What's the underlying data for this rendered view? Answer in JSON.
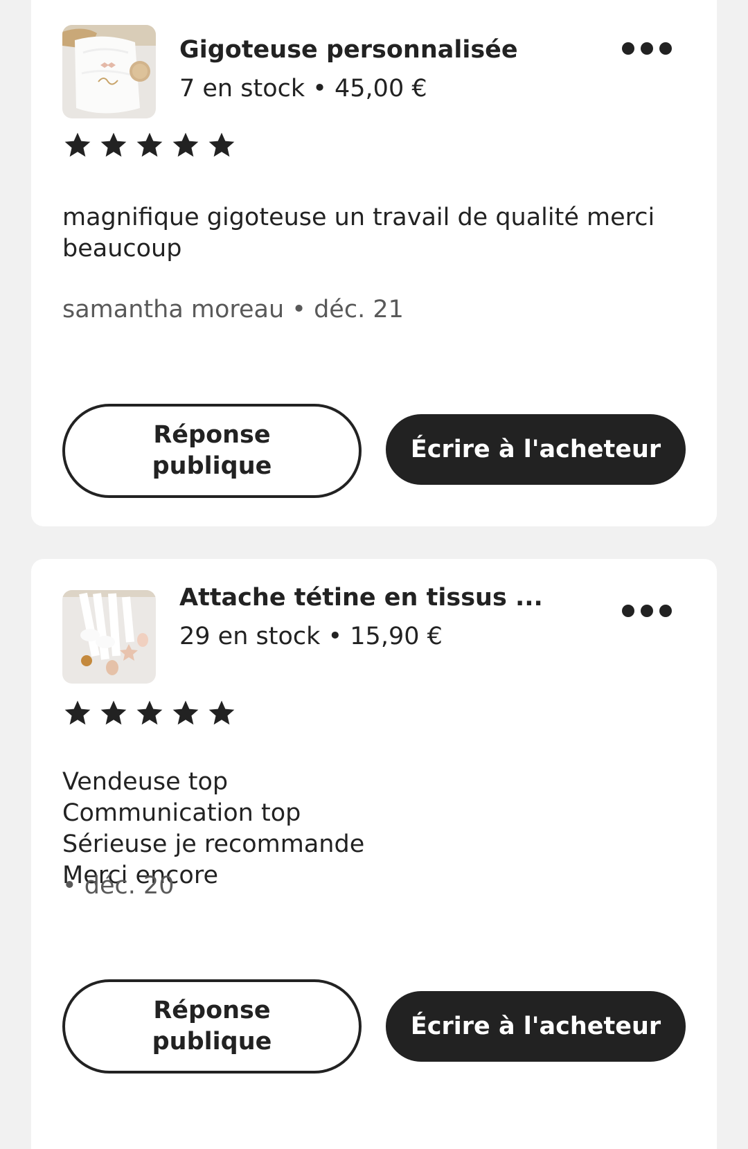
{
  "reviews": [
    {
      "product_title": "Gigoteuse personnalisée",
      "product_meta": "7 en stock • 45,00 €",
      "product_image": "baby-sleeping-bag-photo",
      "rating": 5,
      "review_text": "magnifique gigoteuse un travail de qualité merci beaucoup",
      "byline": "samantha moreau • déc. 21",
      "public_reply_label": "Réponse\npublique",
      "message_buyer_label": "Écrire à l'acheteur",
      "more_icon": "more-horizontal-icon"
    },
    {
      "product_title": "Attache tétine en tissus ...",
      "product_meta": "29 en stock • 15,90 €",
      "product_image": "pacifier-clips-photo",
      "rating": 5,
      "review_text": "Vendeuse top\nCommunication top\nSérieuse je recommande\nMerci encore",
      "byline": " • déc. 20",
      "public_reply_label": "Réponse\npublique",
      "message_buyer_label": "Écrire à l'acheteur",
      "more_icon": "more-horizontal-icon"
    }
  ],
  "colors": {
    "background": "#f1f1f1",
    "card": "#ffffff",
    "text": "#222222",
    "muted": "#595959",
    "primary_button": "#222222"
  }
}
